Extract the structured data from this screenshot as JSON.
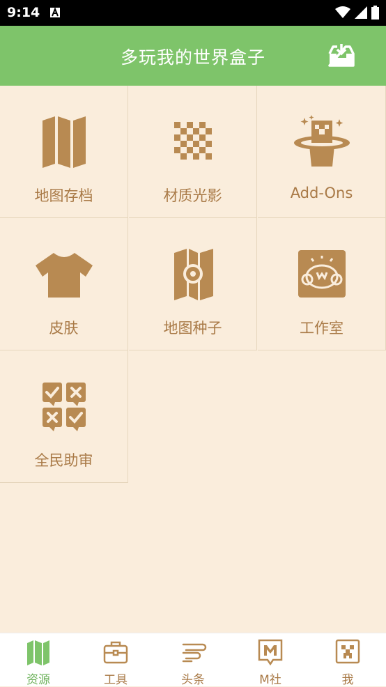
{
  "status_bar": {
    "time": "9:14"
  },
  "header": {
    "title": "多玩我的世界盒子"
  },
  "colors": {
    "accent": "#7ec46a",
    "icon": "#b88a52",
    "background": "#faeddc"
  },
  "grid": {
    "items": [
      {
        "label": "地图存档",
        "icon": "map-icon"
      },
      {
        "label": "材质光影",
        "icon": "checker-icon"
      },
      {
        "label": "Add-Ons",
        "icon": "magic-hat-icon"
      },
      {
        "label": "皮肤",
        "icon": "shirt-icon"
      },
      {
        "label": "地图种子",
        "icon": "map-seed-icon"
      },
      {
        "label": "工作室",
        "icon": "studio-icon"
      },
      {
        "label": "全民助审",
        "icon": "review-icon"
      }
    ]
  },
  "tabs": [
    {
      "label": "资源",
      "icon": "map-icon",
      "active": true
    },
    {
      "label": "工具",
      "icon": "toolbox-icon",
      "active": false
    },
    {
      "label": "头条",
      "icon": "news-icon",
      "active": false
    },
    {
      "label": "M社",
      "icon": "m-community-icon",
      "active": false
    },
    {
      "label": "我",
      "icon": "creeper-icon",
      "active": false
    }
  ]
}
